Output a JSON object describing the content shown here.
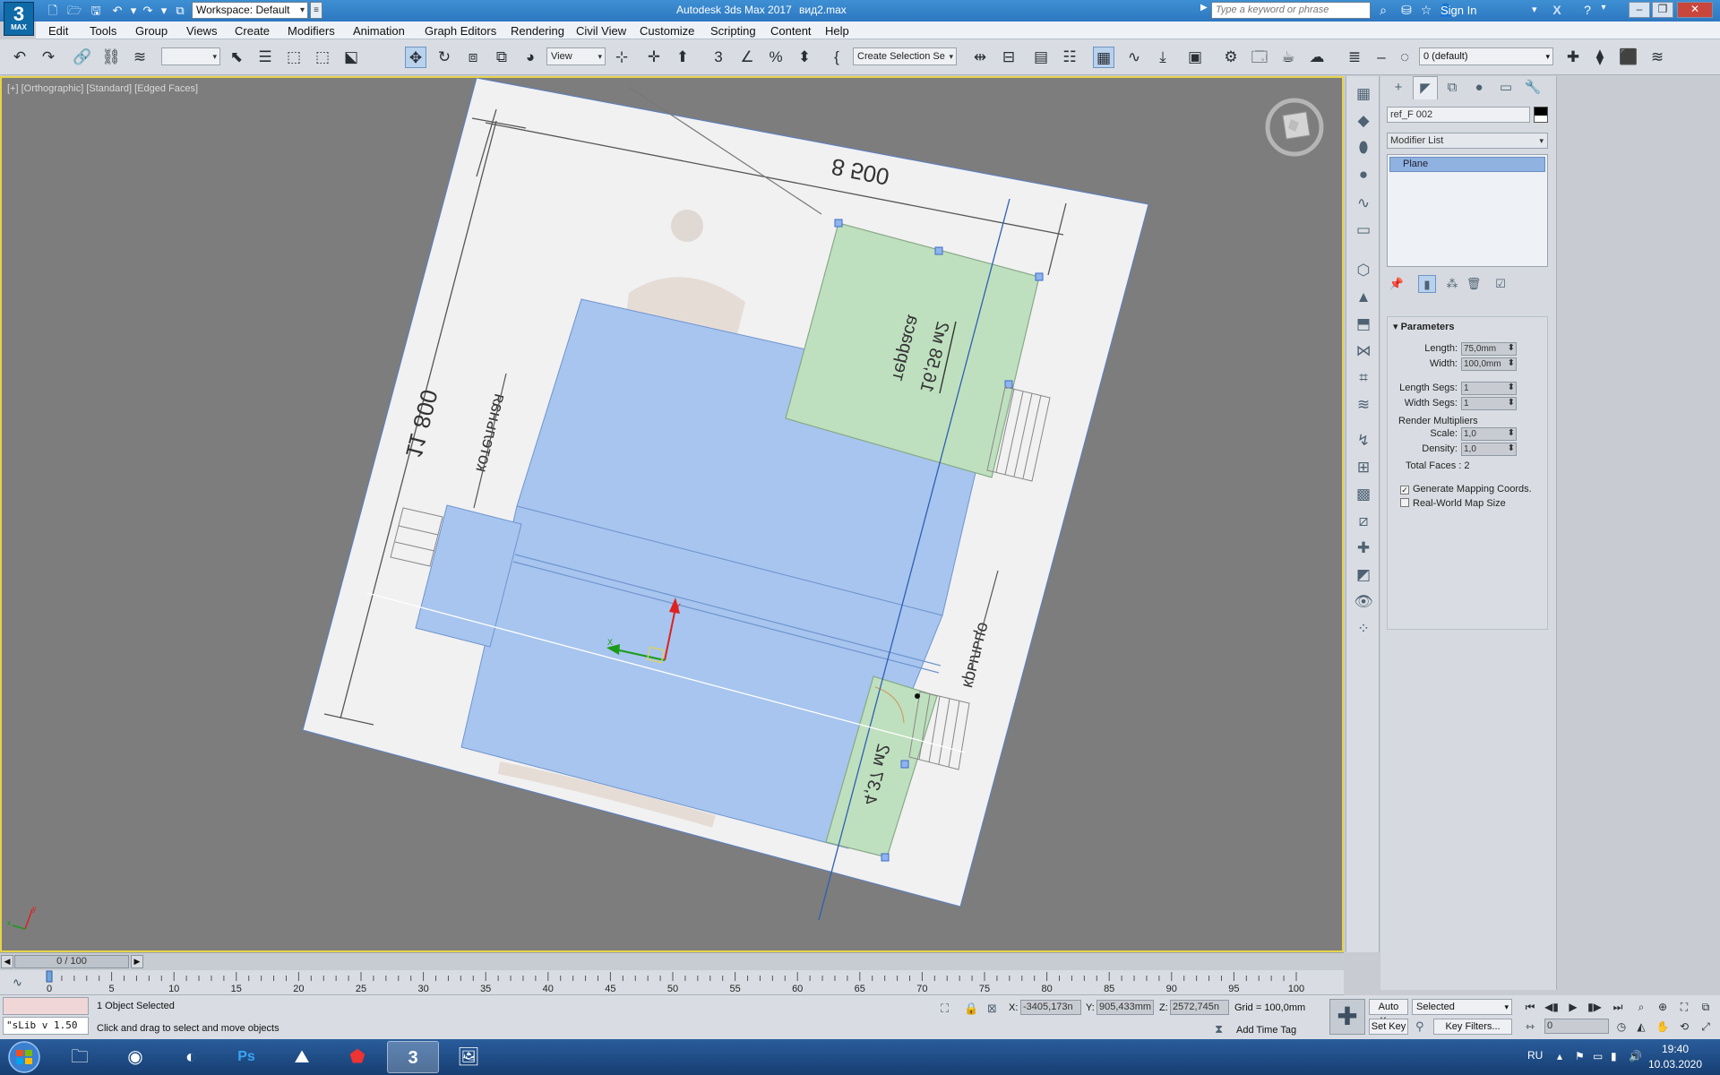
{
  "title_bar": {
    "logo_text": "3",
    "logo_sub": "MAX",
    "workspace": "Workspace: Default",
    "app_title": "Autodesk 3ds Max 2017",
    "file_name": "вид2.max",
    "search_placeholder": "Type a keyword or phrase",
    "sign_in": "Sign In"
  },
  "menu": [
    "Edit",
    "Tools",
    "Group",
    "Views",
    "Create",
    "Modifiers",
    "Animation",
    "Graph Editors",
    "Rendering",
    "Civil View",
    "Customize",
    "Scripting",
    "Content",
    "Help"
  ],
  "toolbar": {
    "reference_coord": "View",
    "selection_set": "Create Selection Se",
    "layer": "0 (default)"
  },
  "viewport": {
    "label": "[+] [Orthographic] [Standard] [Edged Faces]",
    "drawing_texts": {
      "dimension_top": "8 500",
      "dimension_left": "11 800",
      "room_terrace": "терраса",
      "room_terrace_area": "16,58 м2",
      "room_boiler": "котельная",
      "room_porch": "крыльцо",
      "room_small_area": "4,37 м2"
    }
  },
  "command_panel": {
    "object_name": "ref_F 002",
    "modifier_list": "Modifier List",
    "stack_item": "Plane",
    "parameters_title": "Parameters",
    "length_label": "Length:",
    "length_value": "75,0mm",
    "width_label": "Width:",
    "width_value": "100,0mm",
    "length_segs_label": "Length Segs:",
    "length_segs_value": "1",
    "width_segs_label": "Width Segs:",
    "width_segs_value": "1",
    "render_multipliers": "Render Multipliers",
    "scale_label": "Scale:",
    "scale_value": "1,0",
    "density_label": "Density:",
    "density_value": "1,0",
    "total_faces": "Total Faces : 2",
    "gen_mapping": "Generate Mapping Coords.",
    "real_world": "Real-World Map Size",
    "gen_mapping_checked": true,
    "real_world_checked": false
  },
  "timeline": {
    "slider_text": "0 / 100",
    "current_frame": 0,
    "total_frames": 100,
    "tick_labels": [
      "0",
      "5",
      "10",
      "15",
      "20",
      "25",
      "30",
      "35",
      "40",
      "45",
      "50",
      "55",
      "60",
      "65",
      "70",
      "75",
      "80",
      "85",
      "90",
      "95",
      "100"
    ]
  },
  "status": {
    "maxscript": "\"sLib v 1.50",
    "selected": "1 Object Selected",
    "prompt": "Click and drag to select and move objects",
    "x_label": "X:",
    "x_value": "-3405,173n",
    "y_label": "Y:",
    "y_value": "905,433mm",
    "z_label": "Z:",
    "z_value": "2572,745n",
    "grid": "Grid = 100,0mm",
    "add_time_tag": "Add Time Tag",
    "auto_key": "Auto Key",
    "set_key": "Set Key",
    "selected_mode": "Selected",
    "key_filters": "Key Filters...",
    "frame_field": "0"
  },
  "taskbar": {
    "language": "RU",
    "time": "19:40",
    "date": "10.03.2020"
  },
  "colors": {
    "viewport_bg": "#7d7d7d",
    "plan_paper": "#f1f1f1",
    "blue_plane": "#a7c5ee",
    "green_plane": "#bfe0bf",
    "selection_border": "#e5d34a"
  }
}
